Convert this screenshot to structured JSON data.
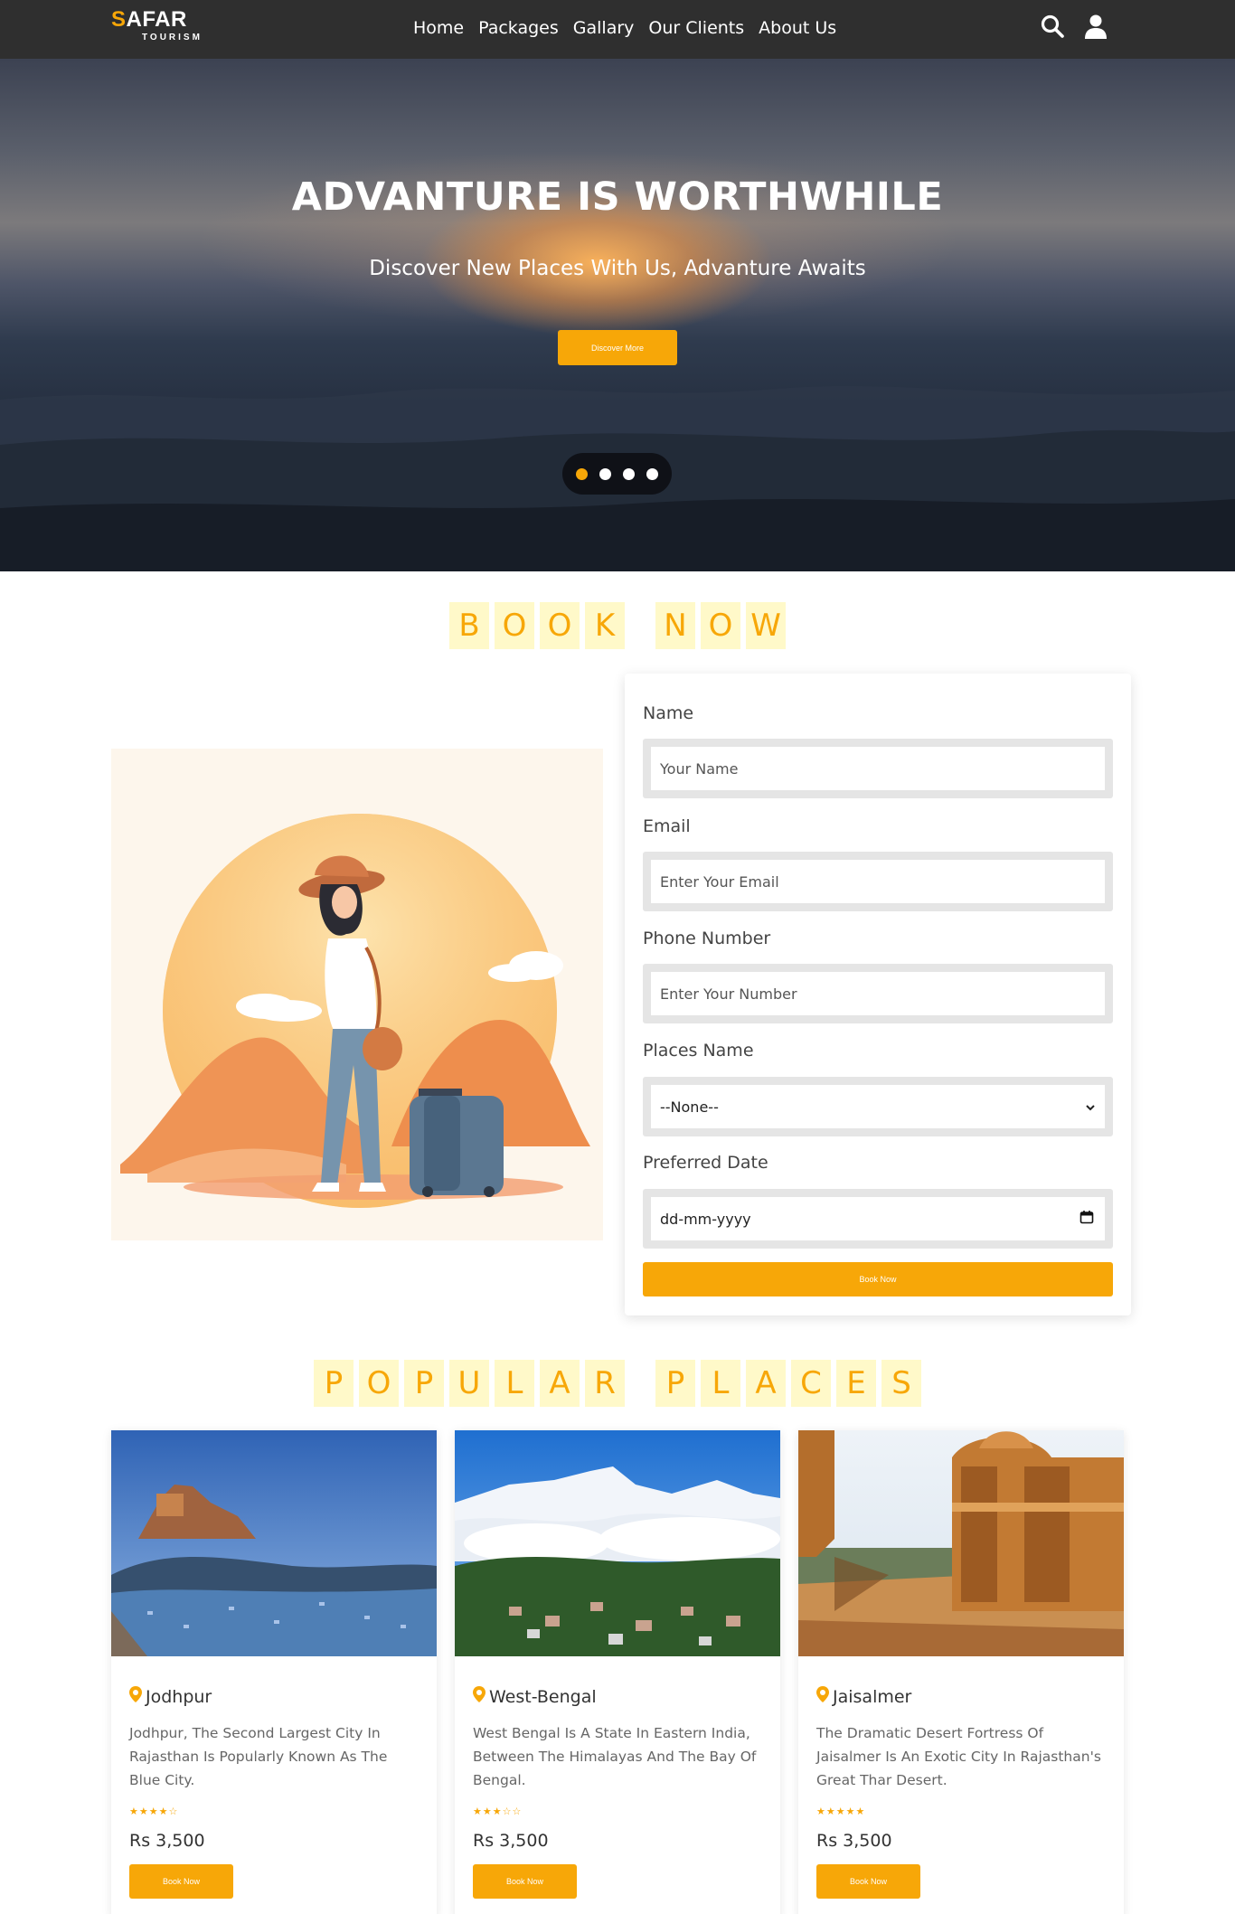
{
  "brand": {
    "name_first": "S",
    "name_rest": "AFAR",
    "tagline": "TOURISM"
  },
  "nav": {
    "items": [
      "Home",
      "Packages",
      "Gallary",
      "Our Clients",
      "About Us"
    ]
  },
  "header_icons": [
    "search-icon",
    "user-icon"
  ],
  "hero": {
    "title": "ADVANTURE IS WORTHWHILE",
    "subtitle": "Discover New Places With Us, Advanture Awaits",
    "button": "Discover More",
    "slides": 4,
    "active_slide": 1
  },
  "book_now": {
    "title_words": [
      "BOOK",
      "NOW"
    ],
    "fields": [
      {
        "label": "Name",
        "placeholder": "Your Name"
      },
      {
        "label": "Email",
        "placeholder": "Enter Your Email"
      },
      {
        "label": "Phone Number",
        "placeholder": "Enter Your Number"
      },
      {
        "label": "Places Name",
        "value": "--None--"
      },
      {
        "label": "Preferred Date",
        "value": "dd-mm-yyyy"
      }
    ],
    "submit": "Book Now"
  },
  "popular": {
    "title_words": [
      "POPULAR",
      "PLACES"
    ],
    "cards": [
      {
        "title": "Jodhpur",
        "desc": "Jodhpur, The Second Largest City In Rajasthan Is Popularly Known As The Blue City.",
        "stars": "★★★★☆",
        "rating": 4,
        "price": "Rs 3,500",
        "button": "Book Now"
      },
      {
        "title": "West-Bengal",
        "desc": "West Bengal Is A State In Eastern India, Between The Himalayas And The Bay Of Bengal.",
        "stars": "★★★☆☆",
        "rating": 3,
        "price": "Rs 3,500",
        "button": "Book Now"
      },
      {
        "title": "Jaisalmer",
        "desc": "The Dramatic Desert Fortress Of Jaisalmer Is An Exotic City In Rajasthan's Great Thar Desert.",
        "stars": "★★★★★",
        "rating": 5,
        "price": "Rs 3,500",
        "button": "Book Now"
      }
    ]
  },
  "colors": {
    "accent": "#f7a708",
    "header_bg": "#2f2f2f",
    "title_tile": "#fff9c9"
  }
}
